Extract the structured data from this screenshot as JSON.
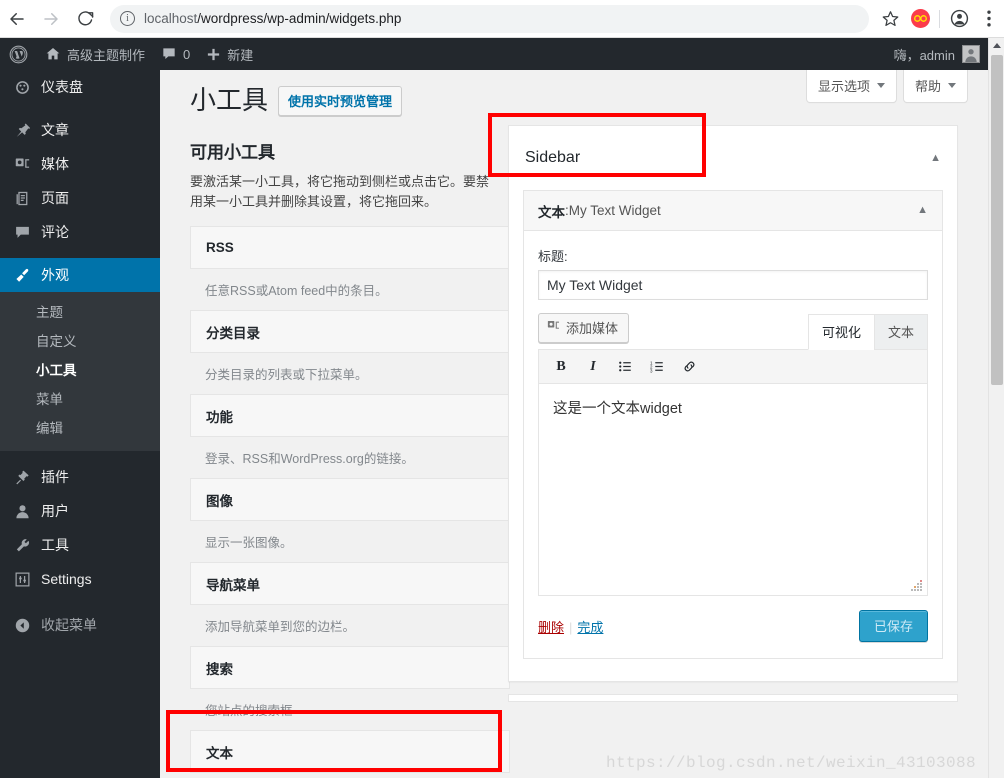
{
  "browser": {
    "back_icon": "arrow-left-icon",
    "forward_icon": "arrow-right-icon",
    "reload_icon": "reload-icon",
    "info_glyph": "i",
    "url_host": "localhost",
    "url_path": "/wordpress/wp-admin/widgets.php",
    "url_full": "localhost/wordpress/wp-admin/widgets.php",
    "star_glyph": "☆",
    "menu_glyph": "⋮"
  },
  "adminbar": {
    "wp_logo": "wordpress-logo",
    "site_name": "高级主题制作",
    "comments_count": "0",
    "new_label": "新建",
    "howdy": "嗨，admin"
  },
  "adminmenu": {
    "items": [
      {
        "label": "仪表盘",
        "icon": "dashboard-icon"
      },
      {
        "label": "文章",
        "icon": "pin-icon"
      },
      {
        "label": "媒体",
        "icon": "media-icon"
      },
      {
        "label": "页面",
        "icon": "page-icon"
      },
      {
        "label": "评论",
        "icon": "comment-icon"
      },
      {
        "label": "外观",
        "icon": "appearance-brush-icon",
        "current": true
      },
      {
        "label": "插件",
        "icon": "plugin-icon"
      },
      {
        "label": "用户",
        "icon": "user-icon"
      },
      {
        "label": "工具",
        "icon": "wrench-icon"
      },
      {
        "label": "Settings",
        "icon": "settings-sliders-icon"
      }
    ],
    "appearance_submenu": [
      {
        "label": "主题"
      },
      {
        "label": "自定义"
      },
      {
        "label": "小工具",
        "current": true
      },
      {
        "label": "菜单"
      },
      {
        "label": "编辑"
      }
    ],
    "collapse_label": "收起菜单"
  },
  "screen_meta": {
    "screen_options": "显示选项",
    "help": "帮助"
  },
  "page": {
    "title": "小工具",
    "live_preview_button": "使用实时预览管理"
  },
  "available": {
    "heading": "可用小工具",
    "description": "要激活某一小工具，将它拖动到侧栏或点击它。要禁用某一小工具并删除其设置，将它拖回来。",
    "widgets": [
      {
        "name": "RSS",
        "desc": "任意RSS或Atom feed中的条目。"
      },
      {
        "name": "分类目录",
        "desc": "分类目录的列表或下拉菜单。"
      },
      {
        "name": "功能",
        "desc": "登录、RSS和WordPress.org的链接。"
      },
      {
        "name": "图像",
        "desc": "显示一张图像。"
      },
      {
        "name": "导航菜单",
        "desc": "添加导航菜单到您的边栏。"
      },
      {
        "name": "搜索",
        "desc": "您站点的搜索框"
      },
      {
        "name": "文本",
        "desc": ""
      }
    ]
  },
  "sidebar_panel": {
    "title": "Sidebar",
    "collapse_icon": "chevron-up-icon",
    "widget": {
      "type_label": "文本",
      "name_separator": ": ",
      "instance_name": "My Text Widget",
      "collapse_icon": "chevron-up-icon",
      "title_field_label": "标题:",
      "title_field_value": "My Text Widget",
      "add_media_label": "添加媒体",
      "add_media_icon": "media-icon",
      "tabs": [
        {
          "label": "可视化",
          "active": true
        },
        {
          "label": "文本",
          "active": false
        }
      ],
      "toolbar": [
        {
          "icon": "bold-icon",
          "glyph": "B"
        },
        {
          "icon": "italic-icon",
          "glyph": "I"
        },
        {
          "icon": "bullet-list-icon",
          "glyph": ""
        },
        {
          "icon": "numbered-list-icon",
          "glyph": ""
        },
        {
          "icon": "link-icon",
          "glyph": ""
        }
      ],
      "content": "这是一个文本widget",
      "delete_label": "删除",
      "separator": "|",
      "done_label": "完成",
      "save_button_label": "已保存"
    }
  },
  "annotations": {
    "box1_target": "Sidebar",
    "box2_target": "文本"
  },
  "watermark": "https://blog.csdn.net/weixin_43103088",
  "colors": {
    "wp_blue": "#0073aa",
    "admin_dark": "#23282d",
    "submenu_dark": "#32373c",
    "page_bg": "#f1f1f1",
    "annotation_red": "#ff0000",
    "save_button": "#2ea2cc",
    "delete_red": "#a00"
  }
}
